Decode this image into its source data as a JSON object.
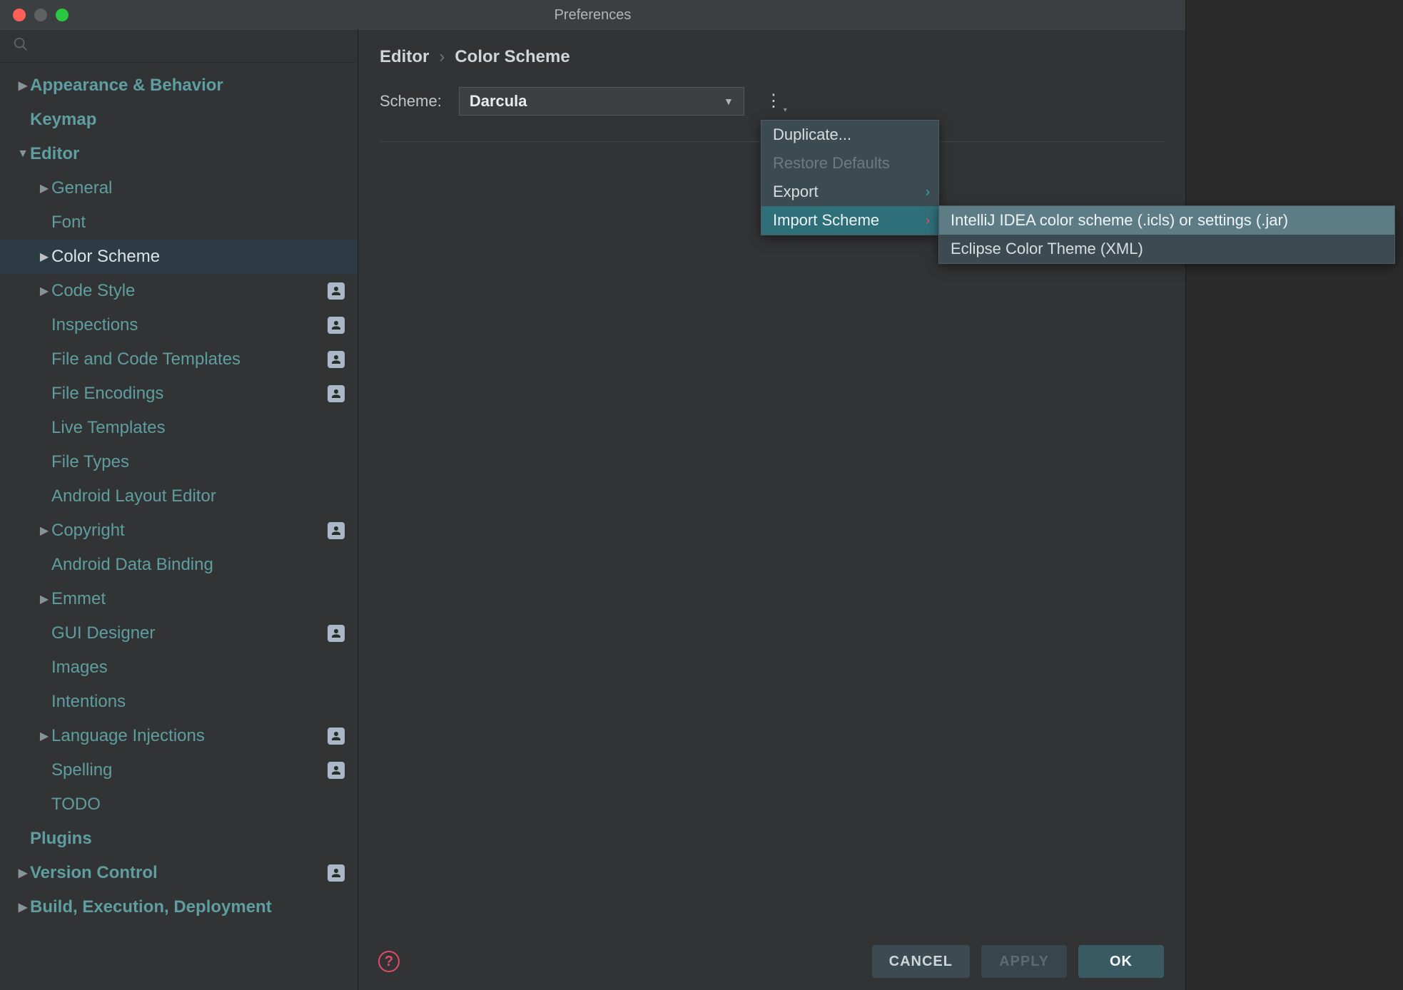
{
  "window": {
    "title": "Preferences"
  },
  "search": {
    "placeholder": ""
  },
  "sidebar": {
    "items": [
      {
        "label": "Appearance & Behavior",
        "level": 0,
        "arrow": "▶",
        "bold": true
      },
      {
        "label": "Keymap",
        "level": 0,
        "arrow": "",
        "bold": true
      },
      {
        "label": "Editor",
        "level": 0,
        "arrow": "▼",
        "bold": true
      },
      {
        "label": "General",
        "level": 1,
        "arrow": "▶"
      },
      {
        "label": "Font",
        "level": 1,
        "arrow": ""
      },
      {
        "label": "Color Scheme",
        "level": 1,
        "arrow": "▶",
        "selected": true
      },
      {
        "label": "Code Style",
        "level": 1,
        "arrow": "▶",
        "badge": true
      },
      {
        "label": "Inspections",
        "level": 1,
        "arrow": "",
        "badge": true
      },
      {
        "label": "File and Code Templates",
        "level": 1,
        "arrow": "",
        "badge": true
      },
      {
        "label": "File Encodings",
        "level": 1,
        "arrow": "",
        "badge": true
      },
      {
        "label": "Live Templates",
        "level": 1,
        "arrow": ""
      },
      {
        "label": "File Types",
        "level": 1,
        "arrow": ""
      },
      {
        "label": "Android Layout Editor",
        "level": 1,
        "arrow": ""
      },
      {
        "label": "Copyright",
        "level": 1,
        "arrow": "▶",
        "badge": true
      },
      {
        "label": "Android Data Binding",
        "level": 1,
        "arrow": ""
      },
      {
        "label": "Emmet",
        "level": 1,
        "arrow": "▶"
      },
      {
        "label": "GUI Designer",
        "level": 1,
        "arrow": "",
        "badge": true
      },
      {
        "label": "Images",
        "level": 1,
        "arrow": ""
      },
      {
        "label": "Intentions",
        "level": 1,
        "arrow": ""
      },
      {
        "label": "Language Injections",
        "level": 1,
        "arrow": "▶",
        "badge": true
      },
      {
        "label": "Spelling",
        "level": 1,
        "arrow": "",
        "badge": true
      },
      {
        "label": "TODO",
        "level": 1,
        "arrow": ""
      },
      {
        "label": "Plugins",
        "level": 0,
        "arrow": "",
        "bold": true
      },
      {
        "label": "Version Control",
        "level": 0,
        "arrow": "▶",
        "bold": true,
        "badge": true
      },
      {
        "label": "Build, Execution, Deployment",
        "level": 0,
        "arrow": "▶",
        "bold": true
      }
    ]
  },
  "breadcrumb": {
    "root": "Editor",
    "sep": "›",
    "leaf": "Color Scheme"
  },
  "scheme": {
    "label": "Scheme:",
    "selected": "Darcula"
  },
  "dropdown": {
    "items": [
      {
        "label": "Duplicate..."
      },
      {
        "label": "Restore Defaults",
        "disabled": true
      },
      {
        "label": "Export",
        "submenu": true
      },
      {
        "label": "Import Scheme",
        "submenu": true,
        "hovered": true
      }
    ]
  },
  "submenu": {
    "items": [
      {
        "label": "IntelliJ IDEA color scheme (.icls) or settings (.jar)",
        "selected": true
      },
      {
        "label": "Eclipse Color Theme (XML)"
      }
    ]
  },
  "footer": {
    "cancel": "CANCEL",
    "apply": "APPLY",
    "ok": "OK"
  }
}
